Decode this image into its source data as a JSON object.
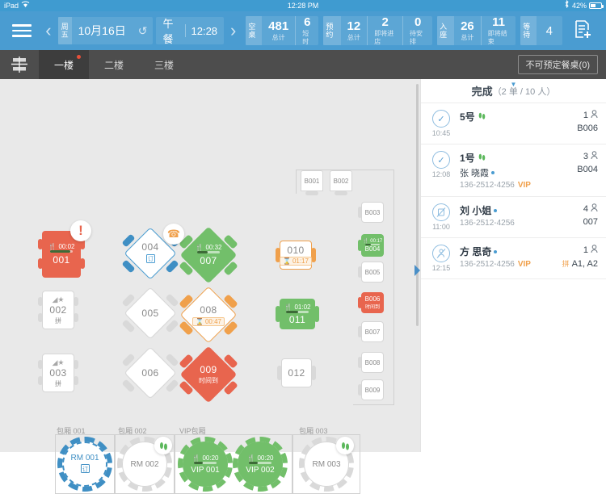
{
  "status_bar": {
    "device": "iPad",
    "wifi_icon": "wifi-icon",
    "time": "12:28 PM",
    "bluetooth_icon": "bluetooth-icon",
    "battery_text": "42%"
  },
  "toolbar": {
    "menu_icon": "hamburger-menu-icon",
    "prev_icon": "chevron-left-icon",
    "next_icon": "chevron-right-icon",
    "weekday": "周五",
    "date": "10月16日",
    "refresh_icon": "refresh-icon",
    "meal": "午餐",
    "meal_time": "12:28",
    "new_order_icon": "new-order-icon",
    "stats": [
      {
        "label": "空桌",
        "cells": [
          {
            "num": "481",
            "cap": "总计"
          },
          {
            "num": "6",
            "cap": "短时"
          }
        ]
      },
      {
        "label": "预约",
        "cells": [
          {
            "num": "12",
            "cap": "总计"
          },
          {
            "num": "2",
            "cap": "即将进店"
          },
          {
            "num": "0",
            "cap": "待安排"
          }
        ]
      },
      {
        "label": "入座",
        "cells": [
          {
            "num": "26",
            "cap": "总计"
          },
          {
            "num": "11",
            "cap": "即将结束"
          }
        ]
      }
    ],
    "wait": {
      "label": "等待",
      "value": "4"
    }
  },
  "floorbar": {
    "layers_icon": "layers-icon",
    "tabs": [
      {
        "label": "一楼",
        "active": true,
        "dot": true
      },
      {
        "label": "二楼",
        "active": false,
        "dot": false
      },
      {
        "label": "三楼",
        "active": false,
        "dot": false
      }
    ],
    "no_reserve_button": "不可预定餐桌(0)"
  },
  "floor_map": {
    "tables": [
      {
        "id": "001",
        "status": "occupied-alert",
        "shape": "rect",
        "color": "red",
        "timer": "00:02",
        "timer_icon": "utensils-icon",
        "progress": 90,
        "badge": "alert-icon"
      },
      {
        "id": "002",
        "status": "free",
        "shape": "rect",
        "color": "white",
        "sub": "拼",
        "icons": "merge-star-icon"
      },
      {
        "id": "003",
        "status": "free",
        "shape": "rect",
        "color": "white",
        "sub": "拼",
        "icons": "merge-star-icon"
      },
      {
        "id": "004",
        "status": "reserved",
        "shape": "diamond",
        "color": "blue",
        "sub_icon": "reservation-card-icon",
        "badge": "phone-icon"
      },
      {
        "id": "005",
        "status": "free",
        "shape": "diamond",
        "color": "white"
      },
      {
        "id": "006",
        "status": "free",
        "shape": "diamond",
        "color": "white"
      },
      {
        "id": "007",
        "status": "dining",
        "shape": "diamond",
        "color": "green",
        "timer": "00:32",
        "timer_icon": "utensils-icon",
        "progress": 45
      },
      {
        "id": "008",
        "status": "holding",
        "shape": "diamond",
        "color": "orange",
        "timer": "00:47",
        "timer_icon": "hourglass-icon"
      },
      {
        "id": "009",
        "status": "timeup",
        "shape": "diamond",
        "color": "red",
        "sub": "时间到"
      },
      {
        "id": "010",
        "status": "holding",
        "shape": "rect",
        "color": "orange",
        "timer": "01:17",
        "timer_icon": "hourglass-icon"
      },
      {
        "id": "011",
        "status": "dining",
        "shape": "rect",
        "color": "green",
        "timer": "01:02",
        "timer_icon": "utensils-icon",
        "progress": 55
      },
      {
        "id": "012",
        "status": "free",
        "shape": "rect",
        "color": "white"
      },
      {
        "id": "B001",
        "status": "free",
        "shape": "booth",
        "color": "white"
      },
      {
        "id": "B002",
        "status": "free",
        "shape": "booth",
        "color": "white"
      },
      {
        "id": "B003",
        "status": "free",
        "shape": "rect",
        "color": "white"
      },
      {
        "id": "B004",
        "status": "dining",
        "shape": "rect",
        "color": "green",
        "timer": "00:17",
        "timer_icon": "utensils-icon",
        "progress": 40
      },
      {
        "id": "B005",
        "status": "free",
        "shape": "rect",
        "color": "white"
      },
      {
        "id": "B006",
        "status": "timeup",
        "shape": "rect",
        "color": "red",
        "sub": "时间到"
      },
      {
        "id": "B007",
        "status": "free",
        "shape": "rect",
        "color": "white"
      },
      {
        "id": "B008",
        "status": "free",
        "shape": "rect",
        "color": "white"
      },
      {
        "id": "B009",
        "status": "free",
        "shape": "rect",
        "color": "white"
      }
    ],
    "room_zones": [
      {
        "label": "包厢 001"
      },
      {
        "label": "包厢 002"
      },
      {
        "label": "VIP包厢"
      },
      {
        "label": "包厢 003"
      }
    ],
    "rooms": [
      {
        "id": "RM 001",
        "status": "reserved",
        "color": "blue",
        "sub_icon": "reservation-card-icon"
      },
      {
        "id": "RM 002",
        "status": "free",
        "color": "white",
        "badge": "footprints-icon"
      },
      {
        "id": "VIP 001",
        "status": "dining",
        "color": "green",
        "timer": "00:20",
        "timer_icon": "utensils-icon",
        "progress": 40
      },
      {
        "id": "VIP 002",
        "status": "dining",
        "color": "green",
        "timer": "00:20",
        "timer_icon": "utensils-icon",
        "progress": 40
      },
      {
        "id": "RM 003",
        "status": "free",
        "color": "white",
        "badge": "footprints-icon"
      }
    ]
  },
  "right_panel": {
    "caret_icon": "chevron-down-icon",
    "title": "完成",
    "count": "（2 单 / 10 人）",
    "handle_icon": "panel-collapse-icon",
    "orders": [
      {
        "icon": "check-circle-icon",
        "icon_state": "done",
        "time": "10:45",
        "name": "5号",
        "name_icon": "footprints-icon",
        "customer": "",
        "phone": "",
        "vip": "",
        "pax": "1",
        "pax_icon": "person-icon",
        "table": "B006",
        "merge": ""
      },
      {
        "icon": "check-circle-icon",
        "icon_state": "done",
        "time": "12:08",
        "name": "1号",
        "name_icon": "footprints-icon",
        "customer": "张 晓霞",
        "phone": "136-2512-4256",
        "vip": "VIP",
        "pax": "3",
        "pax_icon": "person-icon",
        "table": "B004",
        "merge": ""
      },
      {
        "icon": "cancel-circle-icon",
        "icon_state": "cancelled",
        "time": "11:00",
        "name": "",
        "name_icon": "",
        "customer": "刘 小姐",
        "phone": "136-2512-4256",
        "vip": "",
        "pax": "4",
        "pax_icon": "person-icon",
        "table": "007",
        "merge": ""
      },
      {
        "icon": "cancel-circle-icon",
        "icon_state": "cancelled",
        "time": "12:15",
        "name": "",
        "name_icon": "",
        "customer": "方 思奇",
        "phone": "136-2512-4256",
        "vip": "VIP",
        "pax": "1",
        "pax_icon": "person-icon",
        "table": "A1, A2",
        "merge": "拼"
      }
    ]
  },
  "colors": {
    "brand_blue": "#4a9cd1",
    "dining_green": "#72bf6a",
    "alert_red": "#e8654e",
    "holding_orange": "#f0a04b",
    "canvas_bg": "#e9e9e9",
    "floorbar_bg": "#4d4d4d"
  }
}
